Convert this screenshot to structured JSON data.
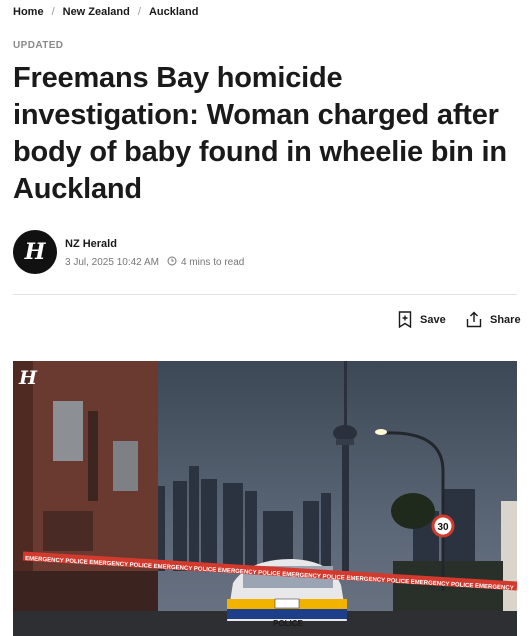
{
  "breadcrumb": {
    "home": "Home",
    "region": "New Zealand",
    "city": "Auckland",
    "separator": "/"
  },
  "article": {
    "status": "UPDATED",
    "headline": "Freemans Bay homicide investigation: Woman charged after body of baby found in wheelie bin in Auckland",
    "author": "NZ Herald",
    "published": "3 Jul, 2025 10:42 AM",
    "read_time": "4 mins to read",
    "publisher_logo_glyph": "H"
  },
  "actions": {
    "save_label": "Save",
    "share_label": "Share"
  },
  "hero": {
    "logo_glyph": "H",
    "tape_text": "EMERGENCY POLICE EMERGENCY POLICE EMERGENCY POLICE EMERGENCY POLICE EMERGENCY POLICE EMERGENCY POLICE EMERGENCY POLICE EMERGENCY",
    "car_text": "POLICE",
    "speed_sign": "30"
  },
  "colors": {
    "text": "#1a1a1a",
    "muted": "#8a8a8a",
    "divider": "#e2e2e2",
    "tape": "#d23a2e"
  }
}
